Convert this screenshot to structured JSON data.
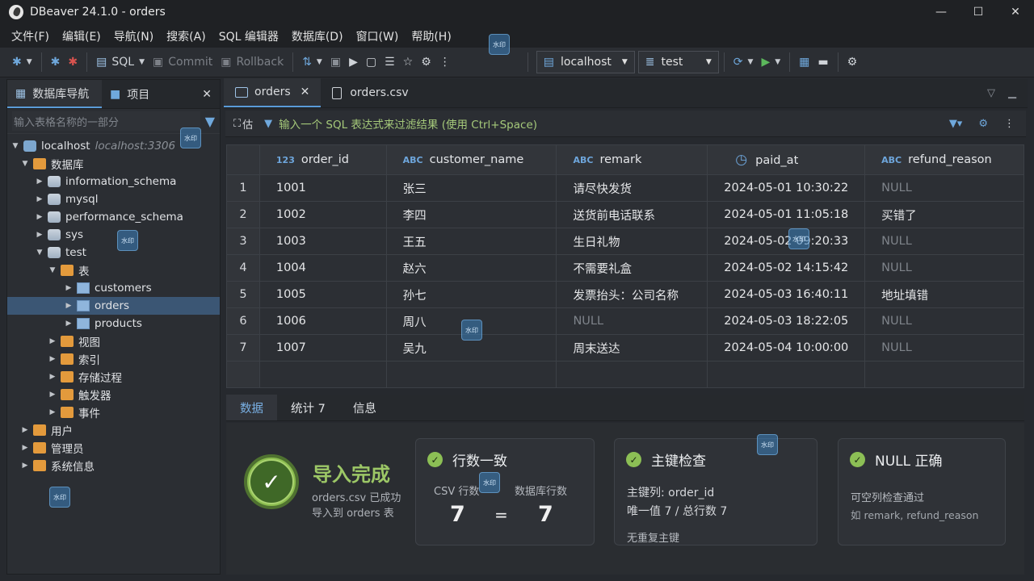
{
  "window": {
    "title": "DBeaver 24.1.0 - orders",
    "minimize": "—",
    "maximize": "☐",
    "close": "✕"
  },
  "menu": [
    "文件(F)",
    "编辑(E)",
    "导航(N)",
    "搜索(A)",
    "SQL 编辑器",
    "数据库(D)",
    "窗口(W)",
    "帮助(H)"
  ],
  "toolbar": {
    "sql_label": "SQL",
    "commit_label": "Commit",
    "rollback_label": "Rollback",
    "connection": "localhost",
    "schema": "test"
  },
  "navigator": {
    "tab_db": "数据库导航",
    "tab_project": "项目",
    "search_placeholder": "输入表格名称的一部分",
    "tree": {
      "host": "localhost",
      "host_sub": "localhost:3306",
      "databases": "数据库",
      "schemas": [
        "information_schema",
        "mysql",
        "performance_schema",
        "sys"
      ],
      "test": "test",
      "tables": "表",
      "table_items": [
        "customers",
        "orders",
        "products"
      ],
      "folders": [
        "视图",
        "索引",
        "存储过程",
        "触发器",
        "事件"
      ],
      "root_folders": [
        "用户",
        "管理员",
        "系统信息"
      ]
    }
  },
  "editor": {
    "tab_active": "orders",
    "tab_other": "orders.csv",
    "filter_hint": "输入一个 SQL 表达式来过滤结果 (使用 Ctrl+Space)",
    "filter_prefix": "估"
  },
  "grid": {
    "columns": [
      {
        "type": "123",
        "name": "order_id"
      },
      {
        "type": "ABC",
        "name": "customer_name"
      },
      {
        "type": "ABC",
        "name": "remark"
      },
      {
        "type": "clock",
        "name": "paid_at"
      },
      {
        "type": "ABC",
        "name": "refund_reason"
      }
    ],
    "rows": [
      [
        "1",
        "1001",
        "张三",
        "请尽快发货",
        "2024-05-01 10:30:22",
        "NULL"
      ],
      [
        "2",
        "1002",
        "李四",
        "送货前电话联系",
        "2024-05-01 11:05:18",
        "买错了"
      ],
      [
        "3",
        "1003",
        "王五",
        "生日礼物",
        "2024-05-02 09:20:33",
        "NULL"
      ],
      [
        "4",
        "1004",
        "赵六",
        "不需要礼盒",
        "2024-05-02 14:15:42",
        "NULL"
      ],
      [
        "5",
        "1005",
        "孙七",
        "发票抬头：公司名称",
        "2024-05-03 16:40:11",
        "地址填错"
      ],
      [
        "6",
        "1006",
        "周八",
        "NULL",
        "2024-05-03 18:22:05",
        "NULL"
      ],
      [
        "7",
        "1007",
        "吴九",
        "周末送达",
        "2024-05-04 10:00:00",
        "NULL"
      ]
    ]
  },
  "bottom_tabs": [
    "数据",
    "统计 7",
    "信息"
  ],
  "summary": {
    "done_title": "导入完成",
    "done_sub_1": "orders.csv 已成功",
    "done_sub_2": "导入到 orders 表",
    "card1": {
      "title": "行数一致",
      "csv_label": "CSV 行数",
      "db_label": "数据库行数",
      "csv_value": "7",
      "eq": "=",
      "db_value": "7"
    },
    "card2": {
      "title": "主键检查",
      "line1": "主键列: order_id",
      "line2": "唯一值  7  /  总行数  7",
      "line3": "无重复主键"
    },
    "card3": {
      "title": "NULL 正确",
      "line1": "可空列检查通过",
      "line2": "如 remark, refund_reason"
    }
  },
  "watermark": "水印"
}
